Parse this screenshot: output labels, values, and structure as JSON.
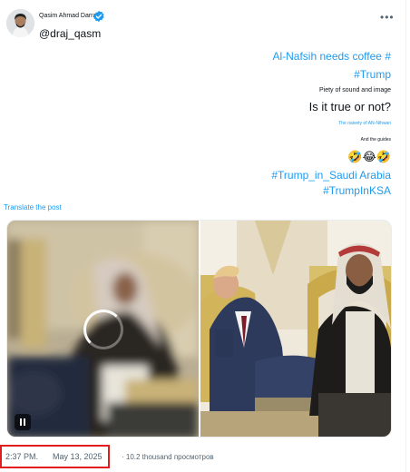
{
  "header": {
    "display_name": "Qasim Ahmad Darraj",
    "handle": "@draj_qasm",
    "verified_icon": "verified-badge-icon",
    "more_icon": "more-horizontal-icon",
    "more_label": "•••"
  },
  "post_text": [
    "Al-Nafsih needs coffee #",
    "#Trump",
    "Piety of sound and image",
    "Is it true or not?",
    "The naivety of AN-Nihwan",
    "And the guides",
    "🤣😂🤣",
    "#Trump_in_Saudi Arabia",
    "#TrumpInKSA"
  ],
  "translate_label": "Translate the post",
  "media": {
    "left_panel": "video-frame-blurred",
    "right_panel": "photo-seated-men",
    "spinner_icon": "loading-spinner-icon",
    "pause_icon": "pause-icon"
  },
  "meta": {
    "time": "2:37 PM.",
    "date": "May 13, 2025",
    "views": "· 10.2 thousand просмотров"
  },
  "colors": {
    "link": "#1d9bf0",
    "text": "#0f1419",
    "secondary": "#536471",
    "highlight": "#e11d1d"
  }
}
